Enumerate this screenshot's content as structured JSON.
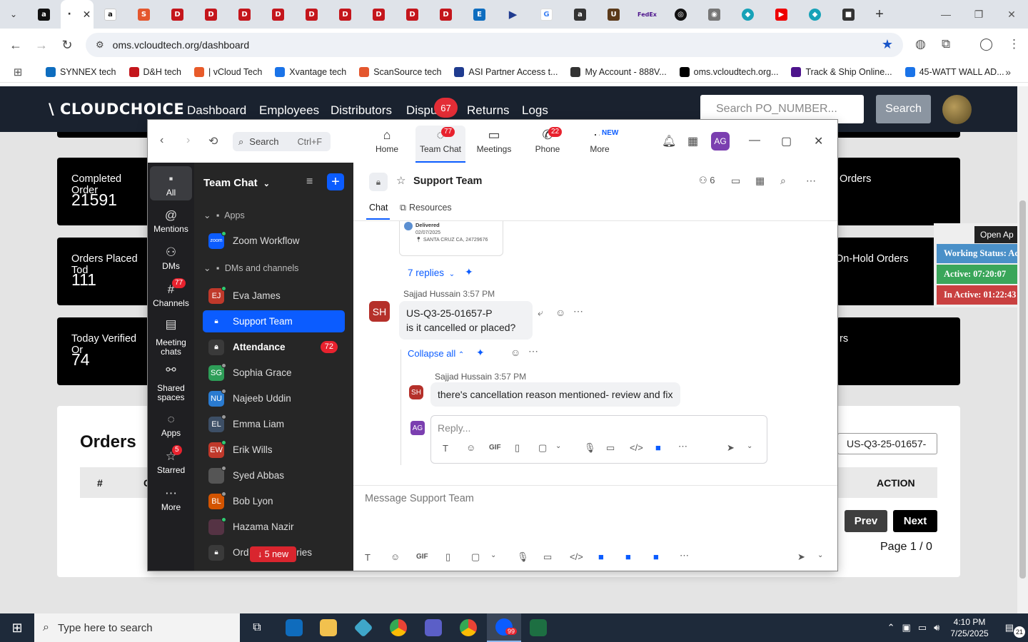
{
  "browser": {
    "url": "oms.vcloudtech.org/dashboard",
    "bookmarks": [
      {
        "label": "SYNNEX tech",
        "color": "#0e6dbf"
      },
      {
        "label": "D&H tech",
        "color": "#c4161c"
      },
      {
        "label": "| vCloud Tech",
        "color": "#e85b2a"
      },
      {
        "label": "Xvantage tech",
        "color": "#1a73e8"
      },
      {
        "label": "ScanSource tech",
        "color": "#e4572e"
      },
      {
        "label": "ASI Partner Access t...",
        "color": "#1f3b8f"
      },
      {
        "label": "My Account - 888V...",
        "color": "#333333"
      },
      {
        "label": "oms.vcloudtech.org...",
        "color": "#000000"
      },
      {
        "label": "Track & Ship Online...",
        "color": "#4d148c"
      },
      {
        "label": "45-WATT WALL AD...",
        "color": "#1a73e8"
      }
    ]
  },
  "site": {
    "logo": "\\ CLOUDCHOICE",
    "nav": [
      "Dashboard",
      "Employees",
      "Distributors",
      "Dispu",
      "Returns",
      "Logs"
    ],
    "disputes_badge": "67",
    "search_placeholder": "Search PO_NUMBER...",
    "search_button": "Search",
    "cards": [
      {
        "label": "Completed Order",
        "value": "21591"
      },
      {
        "label": "Orders Placed Tod",
        "value": "111"
      },
      {
        "label": "Today Verified Or",
        "value": "74"
      }
    ],
    "right_cards": [
      "Orders",
      "On-Hold Orders",
      "rs"
    ],
    "orders_title": "Orders",
    "table_headers": [
      "#",
      "C",
      "ACTION"
    ],
    "po_filter_value": "US-Q3-25-01657-",
    "prev_label": "Prev",
    "next_label": "Next",
    "page_info": "Page 1 / 0",
    "status": {
      "open_label": "Open Ap",
      "working": "Working Status: Acti",
      "active": "Active: 07:20:07",
      "inactive": "In Active: 01:22:43"
    }
  },
  "zoom": {
    "search_label": "Search",
    "search_shortcut": "Ctrl+F",
    "tabs": [
      {
        "label": "Home",
        "badge": ""
      },
      {
        "label": "Team Chat",
        "badge": "77"
      },
      {
        "label": "Meetings",
        "badge": ""
      },
      {
        "label": "Phone",
        "badge": "22"
      },
      {
        "label": "More",
        "badge": "NEW"
      }
    ],
    "user_initials": "AG",
    "rail": [
      {
        "label": "All",
        "badge": ""
      },
      {
        "label": "Mentions",
        "badge": ""
      },
      {
        "label": "DMs",
        "badge": ""
      },
      {
        "label": "Channels",
        "badge": "77"
      },
      {
        "label": "Meeting chats",
        "badge": ""
      },
      {
        "label": "Shared spaces",
        "badge": ""
      },
      {
        "label": "Apps",
        "badge": ""
      },
      {
        "label": "Starred",
        "badge": "5"
      },
      {
        "label": "More",
        "badge": ""
      }
    ],
    "list_header": "Team Chat",
    "sections": [
      "Apps",
      "DMs and channels"
    ],
    "app_item": {
      "label": "Zoom Workflow",
      "icon": "zoom"
    },
    "channels": [
      {
        "label": "Eva James",
        "initials": "EJ",
        "color": "#c0392b",
        "status": "#2ecc71",
        "count": ""
      },
      {
        "label": "Support Team",
        "initials": "",
        "color": "",
        "status": "",
        "count": ""
      },
      {
        "label": "Attendance",
        "initials": "",
        "color": "",
        "status": "",
        "count": "72"
      },
      {
        "label": "Sophia Grace",
        "initials": "SG",
        "color": "#2e9e58",
        "status": "#999999",
        "count": ""
      },
      {
        "label": "Najeeb Uddin",
        "initials": "NU",
        "color": "#2a7bd0",
        "status": "#999999",
        "count": ""
      },
      {
        "label": "Emma Liam",
        "initials": "EL",
        "color": "#3d4f66",
        "status": "#999999",
        "count": ""
      },
      {
        "label": "Erik Wills",
        "initials": "EW",
        "color": "#c0392b",
        "status": "#2ecc71",
        "count": ""
      },
      {
        "label": "Syed Abbas",
        "initials": "",
        "color": "#555555",
        "status": "#999999",
        "count": ""
      },
      {
        "label": "Bob Lyon",
        "initials": "BL",
        "color": "#d35400",
        "status": "#999999",
        "count": ""
      },
      {
        "label": "Hazama Nazir",
        "initials": "",
        "color": "#553344",
        "status": "#2ecc71",
        "count": ""
      },
      {
        "label": "Ord          d Quries",
        "initials": "",
        "color": "",
        "status": "",
        "count": ""
      }
    ],
    "new_pill": "↓ 5 new",
    "conversation": {
      "title": "Support Team",
      "member_count": "6",
      "tabs": [
        "Chat",
        "Resources"
      ],
      "card_status": "Delivered",
      "card_date": "02/07/2025",
      "card_location": "SANTA CRUZ CA, 24729676",
      "replies_label": "7 replies",
      "msg1": {
        "author": "Sajjad Hussain",
        "time": "3:57 PM",
        "initials": "SH",
        "line1": "US-Q3-25-01657-P",
        "line2": "is it cancelled or placed?"
      },
      "collapse_label": "Collapse all",
      "msg2": {
        "author": "Sajjad Hussain",
        "time": "3:57 PM",
        "initials": "SH",
        "text": "there's cancellation reason mentioned- review and fix"
      },
      "reply_placeholder": "Reply...",
      "composer_placeholder": "Message Support Team"
    }
  },
  "taskbar": {
    "search_placeholder": "Type here to search",
    "time": "4:10 PM",
    "date": "7/25/2025",
    "notifications": "21",
    "zoom_badge": "99"
  }
}
